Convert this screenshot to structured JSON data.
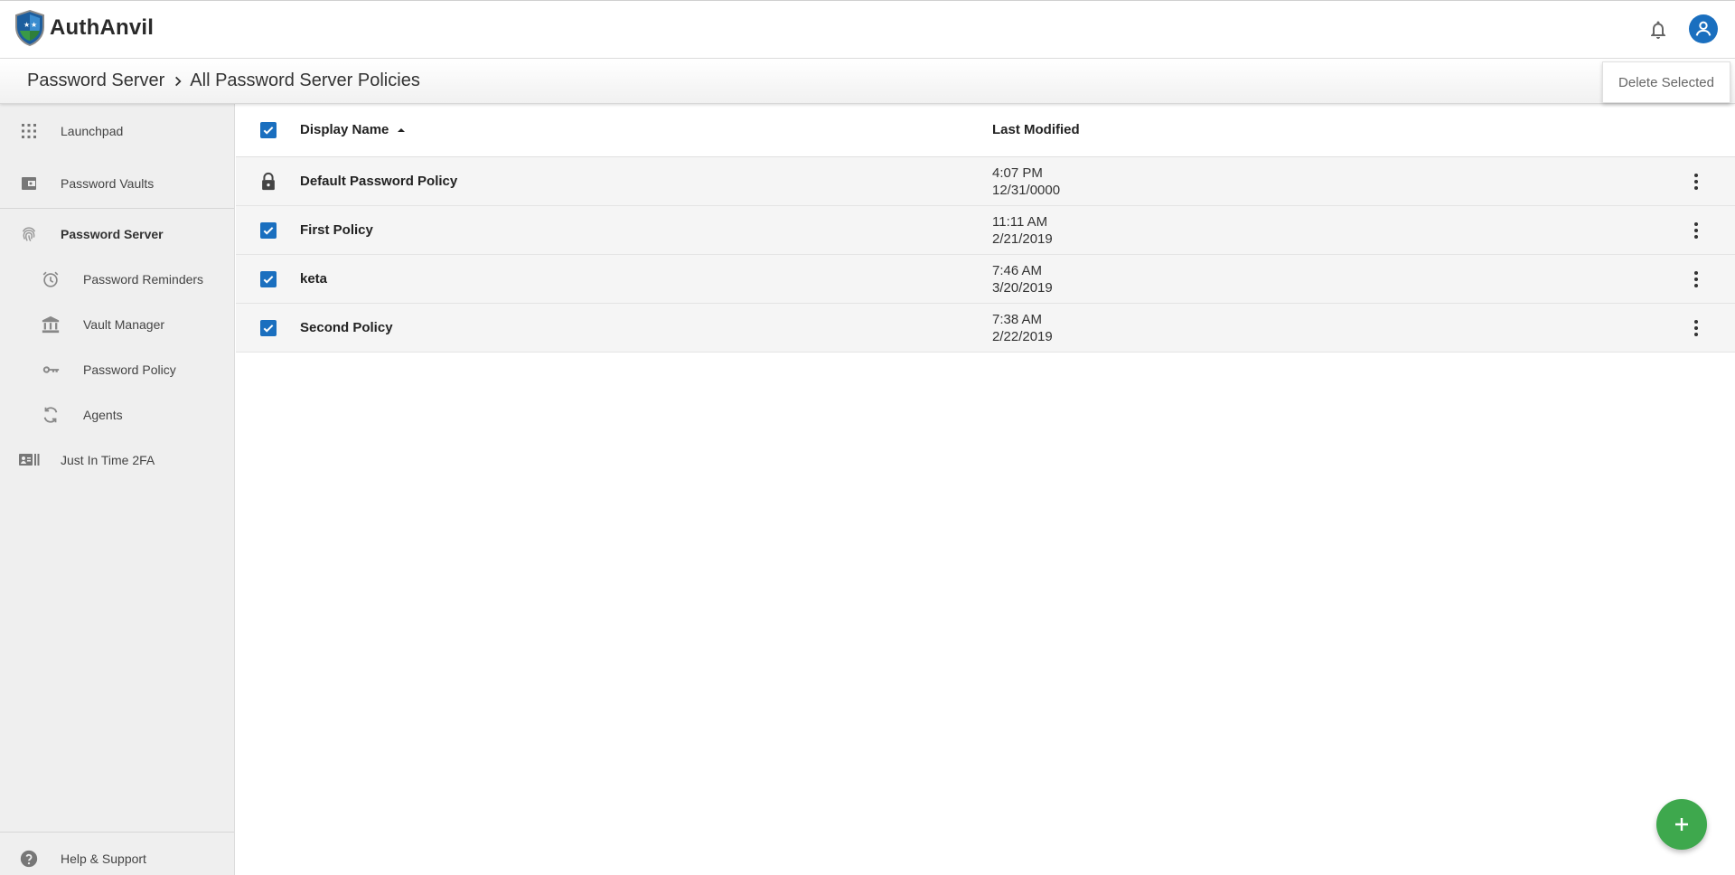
{
  "app": {
    "name": "AuthAnvil"
  },
  "breadcrumb": {
    "parent": "Password Server",
    "current": "All Password Server Policies"
  },
  "toolbar": {
    "delete_label": "Delete Selected"
  },
  "sidebar": {
    "items": [
      {
        "label": "Launchpad",
        "icon": "grid-icon"
      },
      {
        "label": "Password Vaults",
        "icon": "wallet-icon"
      },
      {
        "label": "Password Server",
        "icon": "fingerprint-icon",
        "active": true
      },
      {
        "label": "Password Reminders",
        "icon": "alarm-icon"
      },
      {
        "label": "Vault Manager",
        "icon": "bank-icon"
      },
      {
        "label": "Password Policy",
        "icon": "key-icon"
      },
      {
        "label": "Agents",
        "icon": "sync-icon"
      },
      {
        "label": "Just In Time 2FA",
        "icon": "id-card-icon"
      }
    ],
    "help_label": "Help & Support"
  },
  "table": {
    "columns": {
      "name": "Display Name",
      "modified": "Last Modified"
    },
    "sort": "ascending",
    "select_all_checked": true,
    "rows": [
      {
        "name": "Default Password Policy",
        "time": "4:07 PM",
        "date": "12/31/0000",
        "locked": true
      },
      {
        "name": "First Policy",
        "time": "11:11 AM",
        "date": "2/21/2019",
        "checked": true
      },
      {
        "name": "keta",
        "time": "7:46 AM",
        "date": "3/20/2019",
        "checked": true
      },
      {
        "name": "Second Policy",
        "time": "7:38 AM",
        "date": "2/22/2019",
        "checked": true
      }
    ]
  },
  "colors": {
    "primary": "#1a6fbf",
    "fab": "#3ea84d",
    "sidebar_bg": "#efefef",
    "row_bg": "#f5f5f5"
  }
}
